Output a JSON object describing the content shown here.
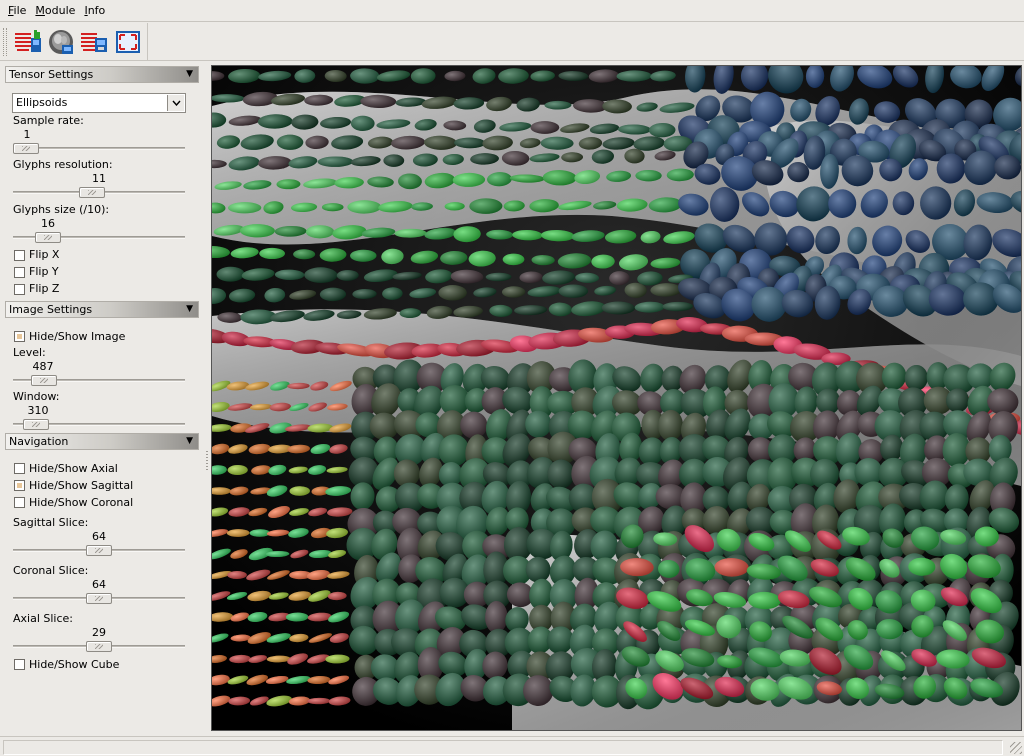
{
  "menu": {
    "file": {
      "u": "F",
      "rest": "ile"
    },
    "module": {
      "u": "M",
      "rest": "odule"
    },
    "info": {
      "u": "I",
      "rest": "nfo"
    }
  },
  "toolbar": {
    "buttons": [
      "tensor-data-icon",
      "brain-volume-icon",
      "tensor-export-icon",
      "fullscreen-icon"
    ]
  },
  "tensor_settings": {
    "header": "Tensor Settings",
    "glyph_type": "Ellipsoids",
    "sample_rate_label": "Sample rate:",
    "sample_rate_value": "1",
    "sample_rate_level": 0.0,
    "glyphs_resolution_label": "Glyphs resolution:",
    "glyphs_resolution_value": "11",
    "glyphs_resolution_level": 0.45,
    "glyphs_size_label": "Glyphs size (/10):",
    "glyphs_size_value": "16",
    "glyphs_size_level": 0.15,
    "flip_x": {
      "label": "Flip X",
      "checked": false
    },
    "flip_y": {
      "label": "Flip Y",
      "checked": false
    },
    "flip_z": {
      "label": "Flip Z",
      "checked": false
    }
  },
  "image_settings": {
    "header": "Image Settings",
    "hide_show_image": {
      "label": "Hide/Show Image",
      "checked": true
    },
    "level_label": "Level:",
    "level_value": "487",
    "level_level": 0.12,
    "window_label": "Window:",
    "window_value": "310",
    "window_level": 0.07
  },
  "navigation": {
    "header": "Navigation",
    "hide_show_axial": {
      "label": "Hide/Show Axial",
      "checked": false
    },
    "hide_show_sagittal": {
      "label": "Hide/Show Sagittal",
      "checked": true
    },
    "hide_show_coronal": {
      "label": "Hide/Show Coronal",
      "checked": false
    },
    "sagittal_slice_label": "Sagittal Slice:",
    "sagittal_slice_value": "64",
    "sagittal_slice_level": 0.5,
    "coronal_slice_label": "Coronal Slice:",
    "coronal_slice_value": "64",
    "coronal_slice_level": 0.5,
    "axial_slice_label": "Axial Slice:",
    "axial_slice_value": "29",
    "axial_slice_level": 0.5,
    "hide_show_cube": {
      "label": "Hide/Show Cube",
      "checked": false
    }
  },
  "colors": {
    "panel_bg": "#eceae6",
    "header_dark": "#8f8d89",
    "checkbox_fill": "#e8c79a",
    "glyph_green": "#2ecc40",
    "glyph_red": "#e0204a",
    "glyph_blue": "#1a2d70"
  }
}
